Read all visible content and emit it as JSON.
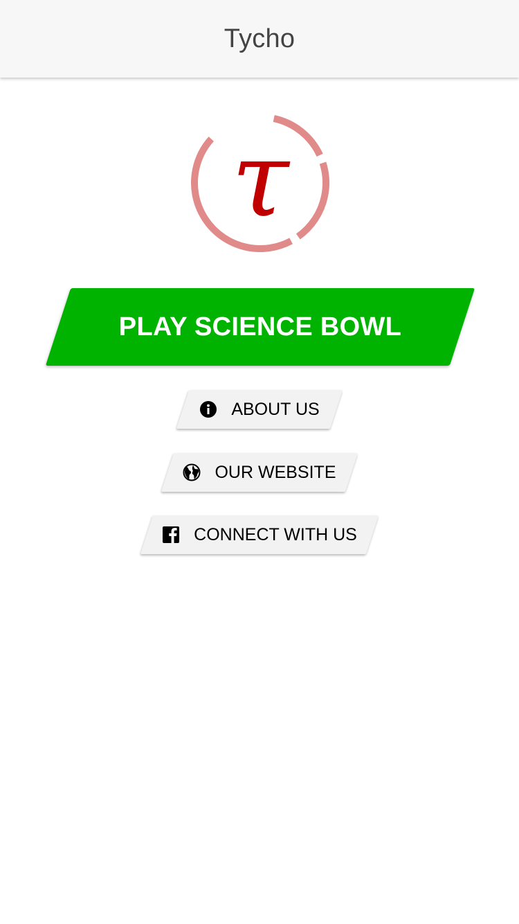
{
  "header": {
    "title": "Tycho"
  },
  "logo": {
    "glyph": "τ",
    "ring_color": "#e08a8a",
    "glyph_color": "#c00000"
  },
  "primary_action": {
    "label": "PLAY SCIENCE BOWL",
    "color": "#00b300"
  },
  "secondary_actions": [
    {
      "label": "ABOUT US",
      "icon": "info-icon"
    },
    {
      "label": "OUR WEBSITE",
      "icon": "globe-icon"
    },
    {
      "label": "CONNECT WITH US",
      "icon": "facebook-icon"
    }
  ]
}
